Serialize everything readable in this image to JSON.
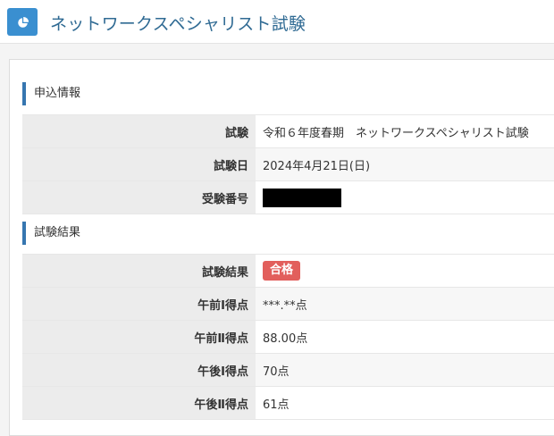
{
  "header": {
    "title": "ネットワークスペシャリスト試験",
    "icon": "pie-chart-icon",
    "accent": "#3a8fd0"
  },
  "application": {
    "heading": "申込情報",
    "rows": [
      {
        "label": "試験",
        "value": "令和６年度春期　ネットワークスペシャリスト試験"
      },
      {
        "label": "試験日",
        "value": "2024年4月21日(日)"
      },
      {
        "label": "受験番号",
        "value": ""
      }
    ]
  },
  "results": {
    "heading": "試験結果",
    "result_label": "試験結果",
    "result_badge": "合格",
    "badge_color": "#e25f5c",
    "rows": [
      {
        "label": "午前Ⅰ得点",
        "value": "***.**点"
      },
      {
        "label": "午前Ⅱ得点",
        "value": "88.00点"
      },
      {
        "label": "午後Ⅰ得点",
        "value": "70点"
      },
      {
        "label": "午後Ⅱ得点",
        "value": "61点"
      }
    ]
  }
}
